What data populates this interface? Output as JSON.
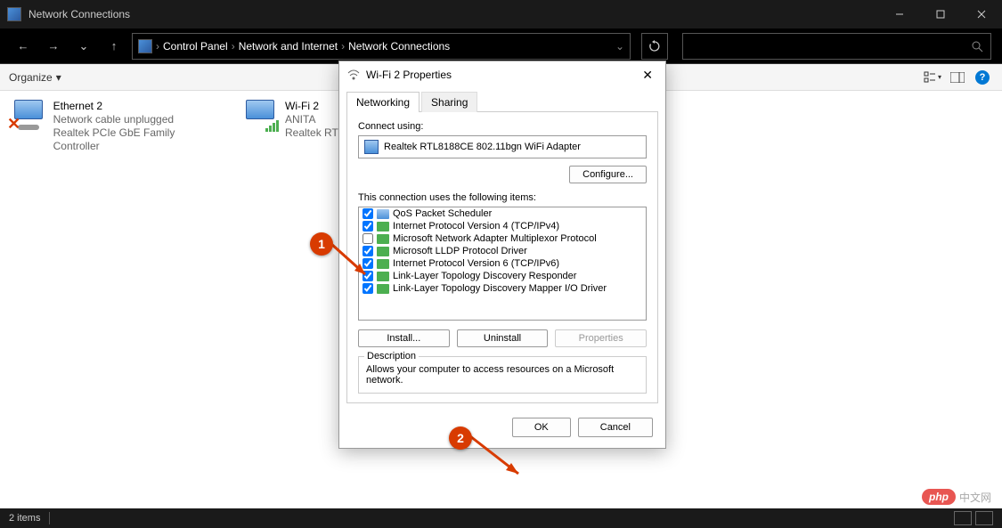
{
  "window": {
    "title": "Network Connections"
  },
  "breadcrumb": {
    "root": "Control Panel",
    "mid": "Network and Internet",
    "leaf": "Network Connections"
  },
  "toolbar": {
    "organize": "Organize"
  },
  "connections": [
    {
      "name": "Ethernet 2",
      "status": "Network cable unplugged",
      "device": "Realtek PCIe GbE Family Controller",
      "type": "ethernet"
    },
    {
      "name": "Wi-Fi 2",
      "status": "ANITA",
      "device": "Realtek RT",
      "type": "wifi"
    }
  ],
  "dialog": {
    "title": "Wi-Fi 2 Properties",
    "tabs": {
      "networking": "Networking",
      "sharing": "Sharing"
    },
    "connect_using_label": "Connect using:",
    "adapter": "Realtek RTL8188CE 802.11bgn WiFi Adapter",
    "configure_btn": "Configure...",
    "items_label": "This connection uses the following items:",
    "items": [
      {
        "checked": true,
        "icon": "blue",
        "label": "QoS Packet Scheduler"
      },
      {
        "checked": true,
        "icon": "green",
        "label": "Internet Protocol Version 4 (TCP/IPv4)"
      },
      {
        "checked": false,
        "icon": "green",
        "label": "Microsoft Network Adapter Multiplexor Protocol"
      },
      {
        "checked": true,
        "icon": "green",
        "label": "Microsoft LLDP Protocol Driver"
      },
      {
        "checked": true,
        "icon": "green",
        "label": "Internet Protocol Version 6 (TCP/IPv6)"
      },
      {
        "checked": true,
        "icon": "green",
        "label": "Link-Layer Topology Discovery Responder"
      },
      {
        "checked": true,
        "icon": "green",
        "label": "Link-Layer Topology Discovery Mapper I/O Driver"
      }
    ],
    "install_btn": "Install...",
    "uninstall_btn": "Uninstall",
    "properties_btn": "Properties",
    "description_legend": "Description",
    "description_text": "Allows your computer to access resources on a Microsoft network.",
    "ok_btn": "OK",
    "cancel_btn": "Cancel"
  },
  "annotations": {
    "one": "1",
    "two": "2"
  },
  "statusbar": {
    "count": "2 items"
  },
  "watermark": {
    "brand": "php",
    "text": "中文网"
  }
}
